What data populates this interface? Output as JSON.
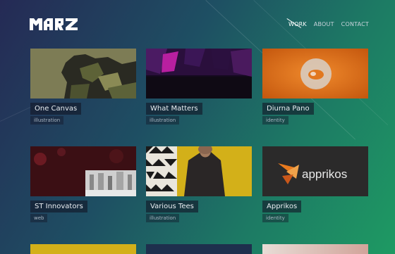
{
  "header": {
    "nav": [
      {
        "label": "WORK",
        "active": true
      },
      {
        "label": "ABOUT",
        "active": false
      },
      {
        "label": "CONTACT",
        "active": false
      }
    ]
  },
  "projects": [
    {
      "title": "One Canvas",
      "category": "illustration"
    },
    {
      "title": "What Matters",
      "category": "illustration"
    },
    {
      "title": "Diurna Pano",
      "category": "identity"
    },
    {
      "title": "ST Innovators",
      "category": "web"
    },
    {
      "title": "Various Tees",
      "category": "illustration"
    },
    {
      "title": "Apprikos",
      "category": "identity",
      "logo_text": "apprikos"
    }
  ],
  "colors": {
    "accent_orange": "#e87a1e",
    "thumb_yellow": "#d3b019",
    "thumb_purple": "#2a0f3c"
  }
}
